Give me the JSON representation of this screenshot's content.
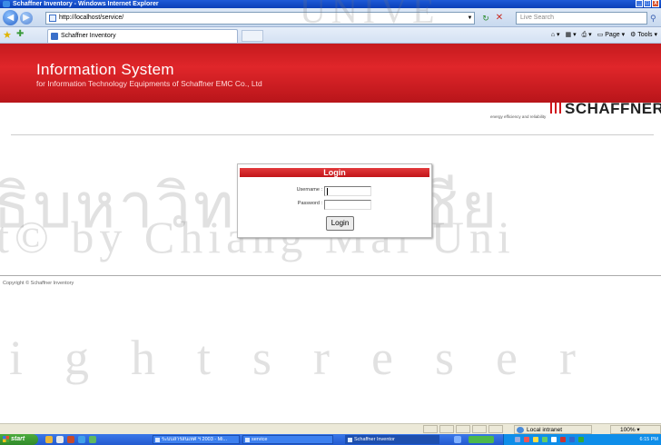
{
  "window": {
    "title": "Schaffner Inventory - Windows Internet Explorer",
    "controls": [
      "_",
      "□",
      "X"
    ]
  },
  "browser": {
    "url": "http://localhost/service/",
    "search_placeholder": "Live Search",
    "tab_title": "Schaffner Inventory",
    "commands": {
      "page": "Page",
      "tools": "Tools"
    }
  },
  "header": {
    "title": "Information System",
    "subtitle": "for Information Technology Equipments of Schaffner EMC Co., Ltd",
    "brand": "SCHAFFNER",
    "brand_tagline": "energy efficiency and reliability"
  },
  "login": {
    "heading": "Login",
    "username_label": "Username :",
    "password_label": "Password :",
    "username_value": "",
    "password_value": "",
    "button_label": "Login"
  },
  "footer": {
    "copyright": "Copyright © Schaffner Inventory"
  },
  "statusbar": {
    "zone": "Local intranet",
    "zoom": "100%"
  },
  "taskbar": {
    "start_label": "start",
    "tasks": [
      "ระบบสารสนเทศ ฯ 2003 - Mi...",
      "service",
      "Schaffner Inventor"
    ],
    "clock": "6:15 PM"
  },
  "watermark": {
    "line0": "UNIVE",
    "line1": "ธิบหาวิทยาลัยเชีย",
    "line2": "t© by Chiang Mai Uni",
    "line3": "ightsreser"
  }
}
